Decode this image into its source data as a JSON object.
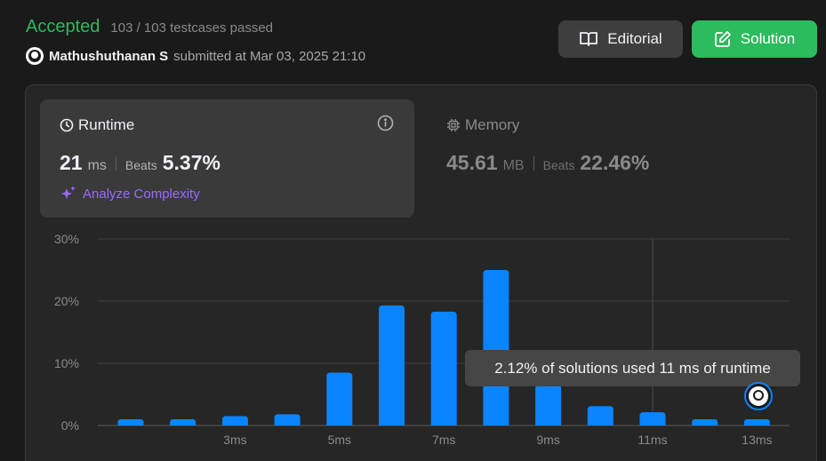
{
  "header": {
    "status": "Accepted",
    "testcases": "103 / 103 testcases passed",
    "author": "Mathushuthanan S",
    "submitted": "submitted at Mar 03, 2025 21:10",
    "editorial_label": "Editorial",
    "solution_label": "Solution"
  },
  "runtime": {
    "title": "Runtime",
    "value": "21",
    "unit": "ms",
    "beats_label": "Beats",
    "beats_pct": "5.37%",
    "analyze_label": "Analyze Complexity"
  },
  "memory": {
    "title": "Memory",
    "value": "45.61",
    "unit": "MB",
    "beats_label": "Beats",
    "beats_pct": "22.46%"
  },
  "tooltip": "2.12% of solutions used 11 ms of runtime",
  "colors": {
    "accent_green": "#2cbb5d",
    "bar_blue": "#0a84ff",
    "analyze_purple": "#9a6bff"
  },
  "chart_data": {
    "type": "bar",
    "ytick_labels": [
      "30%",
      "20%",
      "10%",
      "0%"
    ],
    "ylim": [
      0,
      30
    ],
    "xtick_labels": [
      "3ms",
      "5ms",
      "7ms",
      "9ms",
      "11ms",
      "13ms"
    ],
    "xtick_bar_index": [
      2,
      4,
      6,
      8,
      10,
      12
    ],
    "values": [
      1.0,
      1.0,
      1.5,
      1.8,
      8.5,
      19.3,
      18.3,
      25.0,
      6.5,
      3.1,
      2.12,
      1.0,
      1.0
    ],
    "hover_bar_index": 10,
    "user_bar_index": 12
  }
}
